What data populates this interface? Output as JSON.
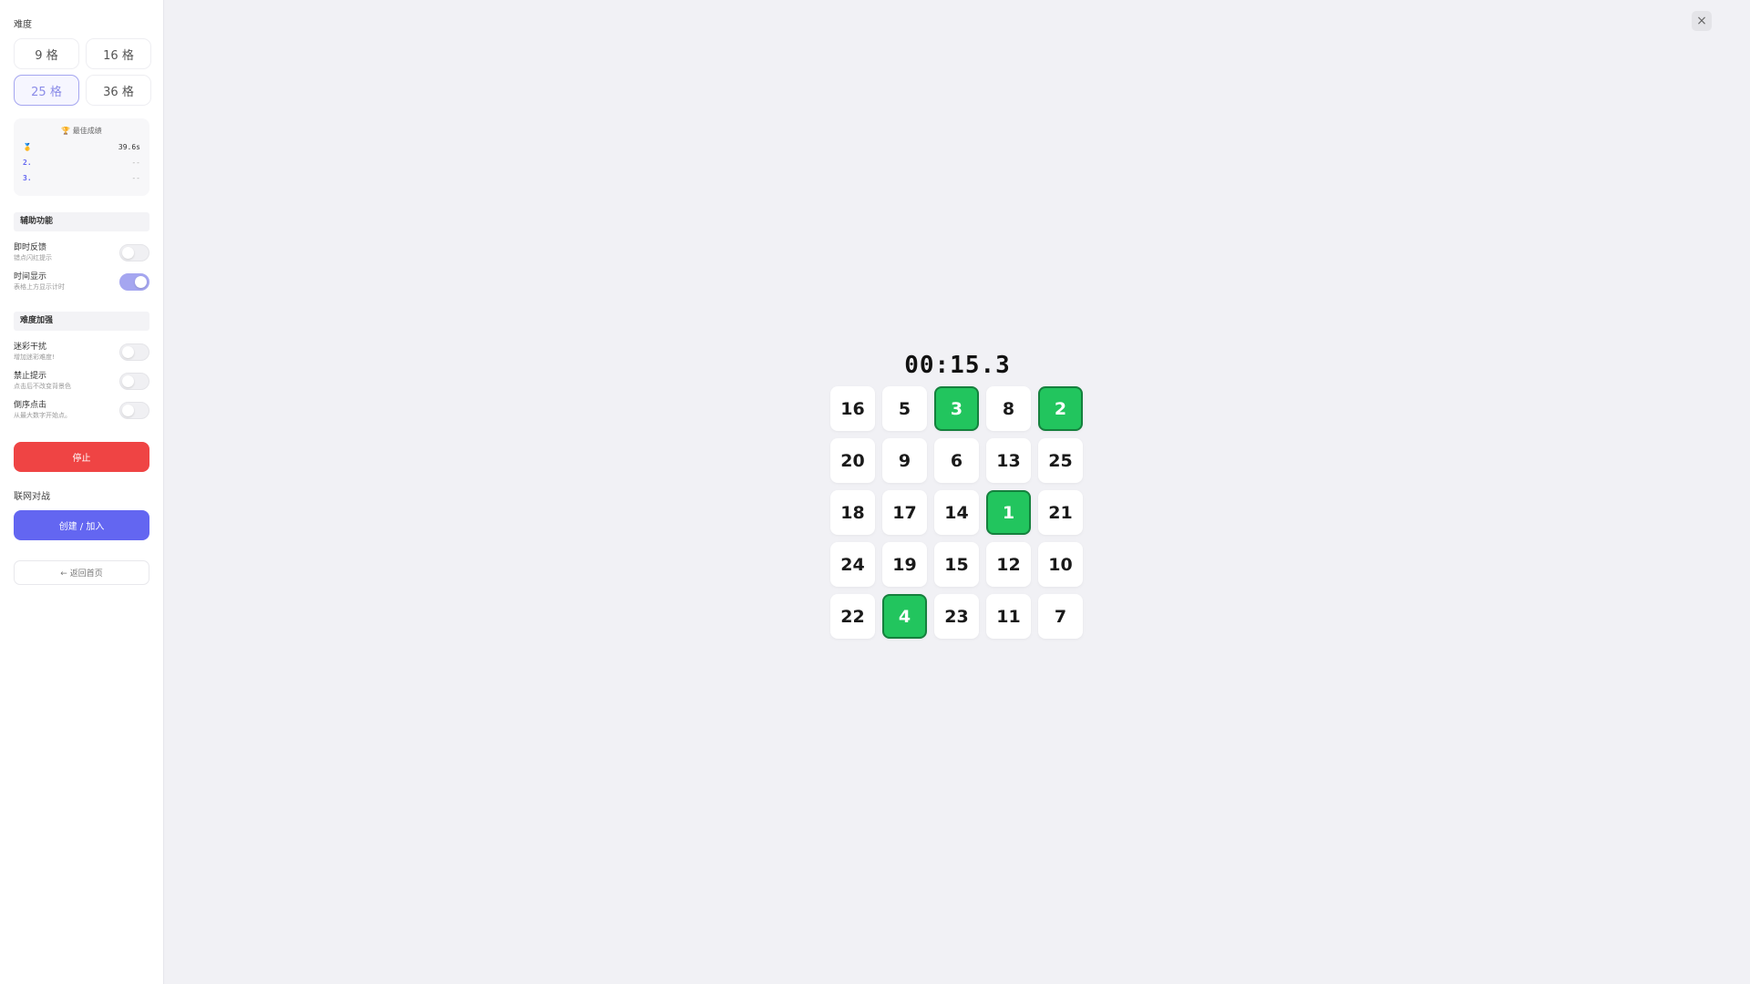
{
  "sidebar": {
    "difficulty_title": "难度",
    "difficulty_options": [
      {
        "label": "9 格",
        "active": false
      },
      {
        "label": "16 格",
        "active": false
      },
      {
        "label": "25 格",
        "active": true
      },
      {
        "label": "36 格",
        "active": false
      }
    ],
    "best_scores": {
      "title": "🏆 最佳成绩",
      "rows": [
        {
          "rank": "🥇",
          "value": "39.6s"
        },
        {
          "rank": "2.",
          "value": "--"
        },
        {
          "rank": "3.",
          "value": "--"
        }
      ]
    },
    "assist_group": {
      "title": "辅助功能",
      "toggles": [
        {
          "label": "即时反馈",
          "desc": "错点闪红提示",
          "on": false
        },
        {
          "label": "时间显示",
          "desc": "表格上方显示计时",
          "on": true
        }
      ]
    },
    "hard_group": {
      "title": "难度加强",
      "toggles": [
        {
          "label": "迷彩干扰",
          "desc": "增加迷彩难度!",
          "on": false
        },
        {
          "label": "禁止提示",
          "desc": "点击后不改变背景色",
          "on": false
        },
        {
          "label": "倒序点击",
          "desc": "从最大数字开始点。",
          "on": false
        }
      ]
    },
    "stop_label": "停止",
    "online_label": "联网对战",
    "create_label": "创建 / 加入",
    "home_label": "← 返回首页"
  },
  "main": {
    "close_label": "×",
    "timer": "00:15.3",
    "cells": [
      {
        "n": "16",
        "done": false
      },
      {
        "n": "5",
        "done": false
      },
      {
        "n": "3",
        "done": true
      },
      {
        "n": "8",
        "done": false
      },
      {
        "n": "2",
        "done": true
      },
      {
        "n": "20",
        "done": false
      },
      {
        "n": "9",
        "done": false
      },
      {
        "n": "6",
        "done": false
      },
      {
        "n": "13",
        "done": false
      },
      {
        "n": "25",
        "done": false
      },
      {
        "n": "18",
        "done": false
      },
      {
        "n": "17",
        "done": false
      },
      {
        "n": "14",
        "done": false
      },
      {
        "n": "1",
        "done": true
      },
      {
        "n": "21",
        "done": false
      },
      {
        "n": "24",
        "done": false
      },
      {
        "n": "19",
        "done": false
      },
      {
        "n": "15",
        "done": false
      },
      {
        "n": "12",
        "done": false
      },
      {
        "n": "10",
        "done": false
      },
      {
        "n": "22",
        "done": false
      },
      {
        "n": "4",
        "done": true
      },
      {
        "n": "23",
        "done": false
      },
      {
        "n": "11",
        "done": false
      },
      {
        "n": "7",
        "done": false
      }
    ]
  },
  "colors": {
    "accent": "#6366f1",
    "accent_light": "#a5a6f0",
    "stop": "#ef4444",
    "done_cell": "#22c55e"
  }
}
